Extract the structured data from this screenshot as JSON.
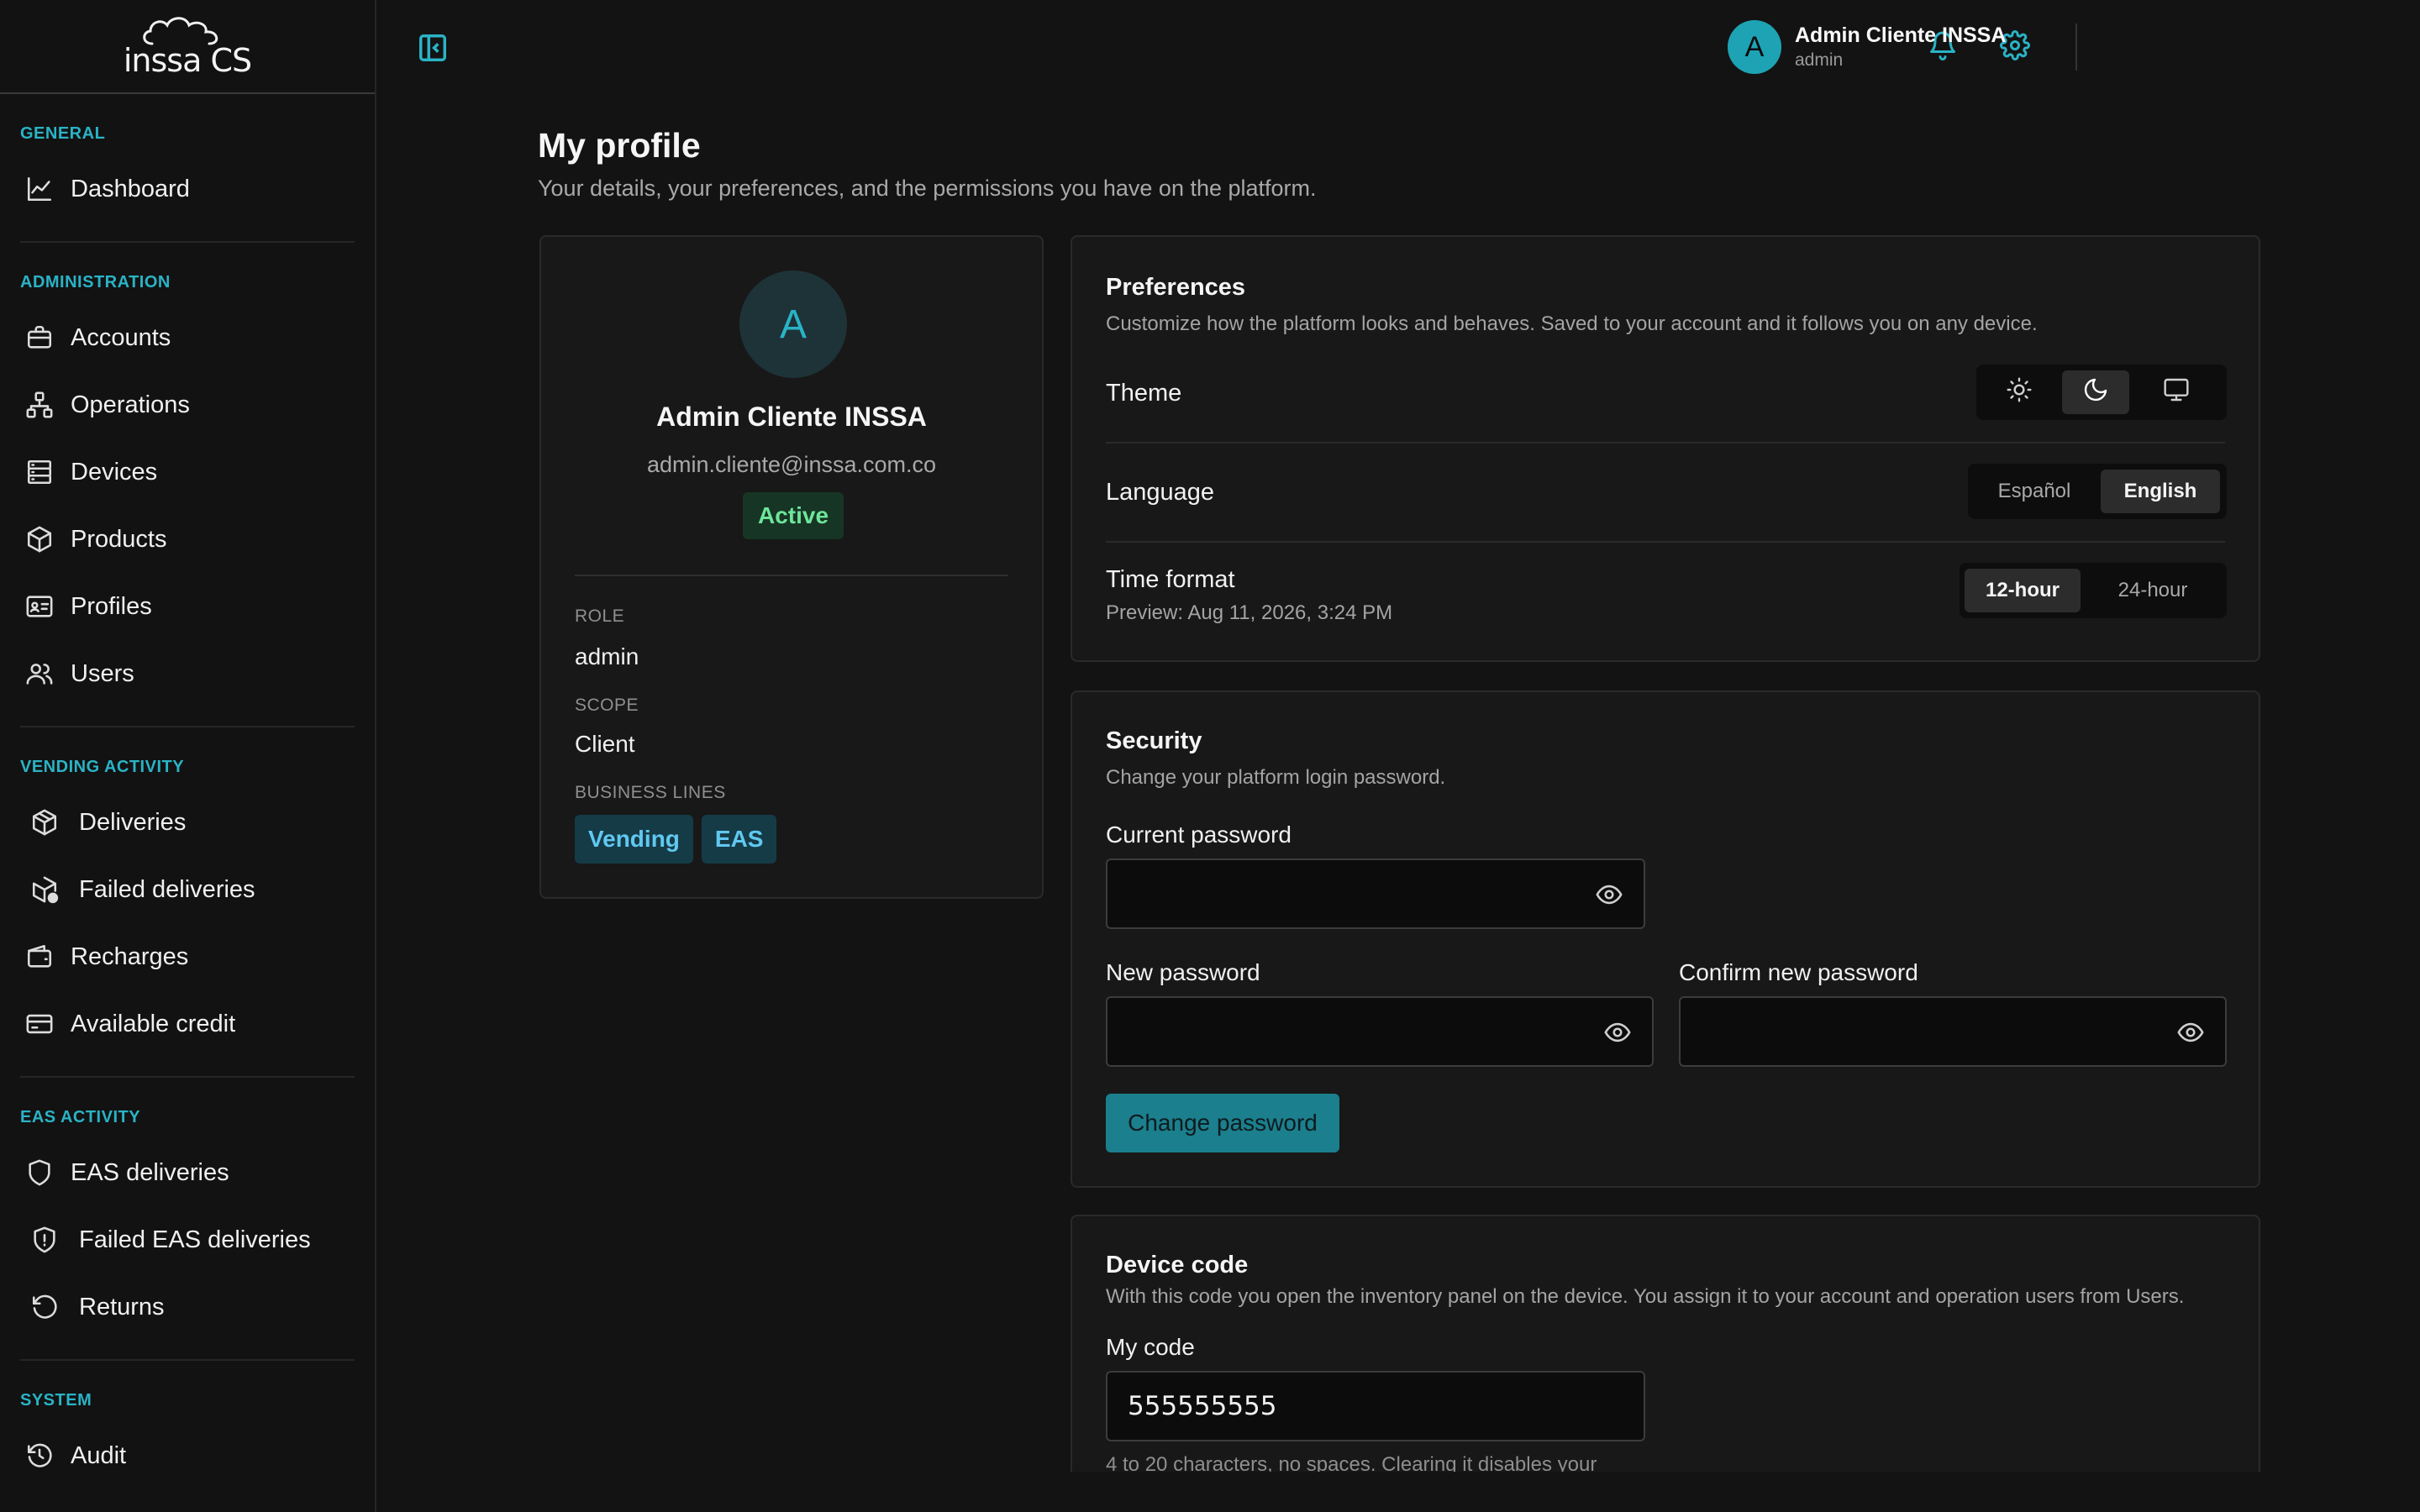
{
  "app": {
    "logo_text": "inssa CS"
  },
  "sidebar": {
    "sections": [
      {
        "title": "GENERAL",
        "items": [
          {
            "label": "Dashboard",
            "icon": "chart-line-icon"
          }
        ]
      },
      {
        "title": "ADMINISTRATION",
        "items": [
          {
            "label": "Accounts",
            "icon": "briefcase-icon"
          },
          {
            "label": "Operations",
            "icon": "network-icon"
          },
          {
            "label": "Devices",
            "icon": "server-icon"
          },
          {
            "label": "Products",
            "icon": "box-icon"
          },
          {
            "label": "Profiles",
            "icon": "id-card-icon"
          },
          {
            "label": "Users",
            "icon": "users-icon"
          }
        ]
      },
      {
        "title": "VENDING ACTIVITY",
        "items": [
          {
            "label": "Deliveries",
            "icon": "package-icon"
          },
          {
            "label": "Failed deliveries",
            "icon": "package-alert-icon"
          },
          {
            "label": "Recharges",
            "icon": "wallet-icon"
          },
          {
            "label": "Available credit",
            "icon": "credit-card-icon"
          }
        ]
      },
      {
        "title": "EAS ACTIVITY",
        "items": [
          {
            "label": "EAS deliveries",
            "icon": "shield-icon"
          },
          {
            "label": "Failed EAS deliveries",
            "icon": "shield-alert-icon"
          },
          {
            "label": "Returns",
            "icon": "rotate-ccw-icon"
          }
        ]
      },
      {
        "title": "SYSTEM",
        "items": [
          {
            "label": "Audit",
            "icon": "history-icon"
          }
        ]
      }
    ]
  },
  "topbar": {
    "user": {
      "initial": "A",
      "name": "Admin Cliente INSSA",
      "role": "admin"
    }
  },
  "page": {
    "title": "My profile",
    "subtitle": "Your details, your preferences, and the permissions you have on the platform."
  },
  "profile": {
    "initial": "A",
    "name": "Admin Cliente INSSA",
    "email": "admin.cliente@inssa.com.co",
    "status": "Active",
    "role_label": "ROLE",
    "role": "admin",
    "scope_label": "SCOPE",
    "scope": "Client",
    "business_lines_label": "BUSINESS LINES",
    "business_lines": [
      "Vending",
      "EAS"
    ]
  },
  "preferences": {
    "title": "Preferences",
    "subtitle": "Customize how the platform looks and behaves. Saved to your account and it follows you on any device.",
    "theme_label": "Theme",
    "theme_selected": "dark",
    "language_label": "Language",
    "language_options": [
      "Español",
      "English"
    ],
    "language_selected": "English",
    "time_format_label": "Time format",
    "time_format_preview": "Preview: Aug 11, 2026, 3:24 PM",
    "time_format_options": [
      "12-hour",
      "24-hour"
    ],
    "time_format_selected": "12-hour"
  },
  "security": {
    "title": "Security",
    "subtitle": "Change your platform login password.",
    "current_password_label": "Current password",
    "new_password_label": "New password",
    "confirm_password_label": "Confirm new password",
    "button_label": "Change password"
  },
  "device_code": {
    "title": "Device code",
    "subtitle": "With this code you open the inventory panel on the device. You assign it to your account and operation users from Users.",
    "field_label": "My code",
    "value": "555555555",
    "helper": "4 to 20 characters, no spaces. Clearing it disables your"
  },
  "colors": {
    "accent": "#2ab3c6",
    "active_green": "#6ee59a",
    "tag_blue": "#61c8f0"
  }
}
